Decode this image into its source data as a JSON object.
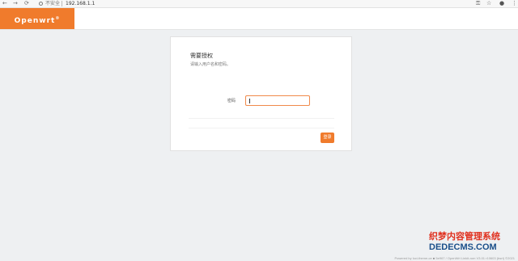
{
  "browser": {
    "security_label": "不安全",
    "url": "192.168.1.1",
    "back_icon": "←",
    "forward_icon": "→",
    "reload_icon": "⟳",
    "key_icon": "⚿",
    "star_icon": "☆",
    "profile_icon": "●",
    "menu_icon": "⋮"
  },
  "header": {
    "brand": "Openwrt",
    "brand_mark": "®",
    "brand_color": "#f07b2c"
  },
  "login": {
    "title": "需要授权",
    "subtitle": "请输入用户名和密码。",
    "password_label": "密码",
    "password_value": "",
    "login_button": "登录"
  },
  "footer": {
    "text": "Powered by luci-theme-ce ■ 5e967 / OpenWrt Linkit-rom V3.01 r10603 (bsrt) ©2021"
  },
  "watermark": {
    "cn": "织梦内容管理系统",
    "en": "DEDECMS.COM"
  }
}
